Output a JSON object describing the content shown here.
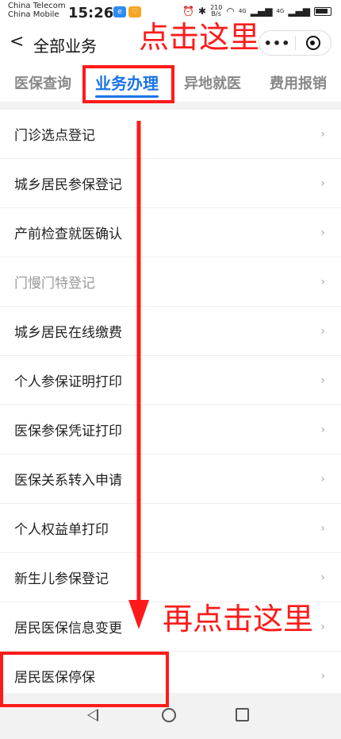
{
  "status_bar": {
    "carrier1": "China Telecom",
    "carrier2": "China Mobile",
    "time": "15:26",
    "net_speed_value": "210",
    "net_speed_unit": "B/s",
    "signal_label1": "4G",
    "signal_label2": "4G"
  },
  "nav": {
    "back_icon": "back-chevron-icon",
    "title": "全部业务",
    "more_label": "•••"
  },
  "tabs": [
    {
      "label": "医保查询",
      "active": false
    },
    {
      "label": "业务办理",
      "active": true
    },
    {
      "label": "异地就医",
      "active": false
    },
    {
      "label": "费用报销",
      "active": false
    }
  ],
  "list": [
    {
      "label": "门诊选点登记"
    },
    {
      "label": "城乡居民参保登记"
    },
    {
      "label": "产前检查就医确认"
    },
    {
      "label": "门慢门特登记",
      "disabled": true
    },
    {
      "label": "城乡居民在线缴费"
    },
    {
      "label": "个人参保证明打印"
    },
    {
      "label": "医保参保凭证打印"
    },
    {
      "label": "医保关系转入申请"
    },
    {
      "label": "个人权益单打印"
    },
    {
      "label": "新生儿参保登记"
    },
    {
      "label": "居民医保信息变更"
    },
    {
      "label": "居民医保停保"
    }
  ],
  "chevron": "›",
  "annotations": {
    "text1": "点击这里",
    "text2": "再点击这里",
    "color": "#ff1a1a"
  },
  "colors": {
    "accent": "#1a73e8"
  }
}
